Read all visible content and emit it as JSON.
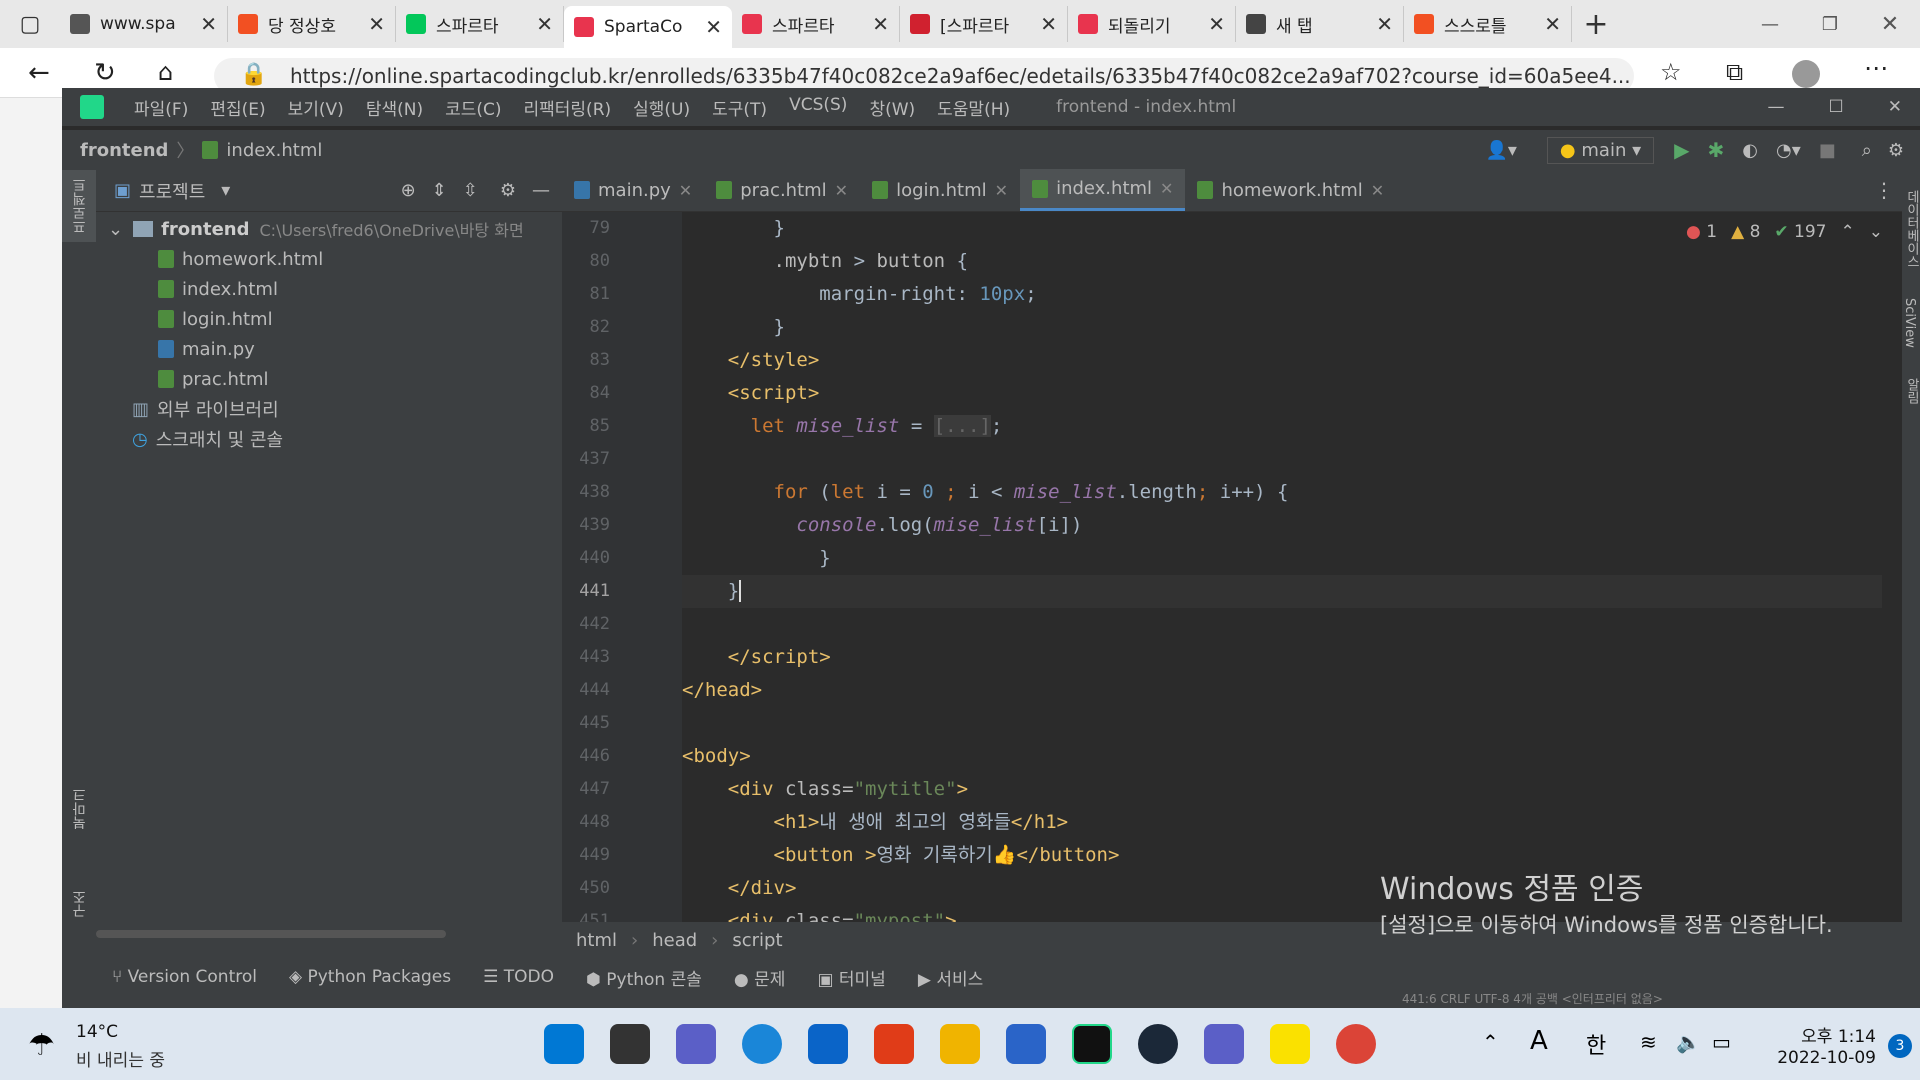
{
  "browser": {
    "tabs": [
      {
        "title": "www.spa",
        "color": "#555555"
      },
      {
        "title": "당 정상호",
        "color": "#f25022"
      },
      {
        "title": "스파르타",
        "color": "#03c75a"
      },
      {
        "title": "SpartaCo",
        "color": "#e8344e"
      },
      {
        "title": "스파르타",
        "color": "#e8344e"
      },
      {
        "title": "[스파르타",
        "color": "#d0212f"
      },
      {
        "title": "되돌리기",
        "color": "#e8344e"
      },
      {
        "title": "새 탭",
        "color": "#444444"
      },
      {
        "title": "스스로틀",
        "color": "#f25022"
      }
    ],
    "url": "https://online.spartacodingclub.kr/enrolleds/6335b47f40c082ce2a9af6ec/edetails/6335b47f40c082ce2a9af702?course_id=60a5ee4..."
  },
  "ide": {
    "menu": [
      "파일(F)",
      "편집(E)",
      "보기(V)",
      "탐색(N)",
      "코드(C)",
      "리팩터링(R)",
      "실행(U)",
      "도구(T)",
      "VCS(S)",
      "창(W)",
      "도움말(H)"
    ],
    "window_title": "frontend - index.html",
    "nav": {
      "project": "frontend",
      "file": "index.html",
      "run_config": "main"
    },
    "left_strip": {
      "project_label": "프로젝트",
      "bookmarks_label": "북마크",
      "structure_label": "구조"
    },
    "right_strip": {
      "db_label": "데이터베이스",
      "sciview_label": "SciView",
      "notif_label": "알림"
    },
    "project_panel": {
      "title": "프로젝트",
      "root": "frontend",
      "root_path": "C:\\Users\\fred6\\OneDrive\\바탕 화면",
      "files": [
        {
          "name": "homework.html",
          "type": "html"
        },
        {
          "name": "index.html",
          "type": "html"
        },
        {
          "name": "login.html",
          "type": "html"
        },
        {
          "name": "main.py",
          "type": "py"
        },
        {
          "name": "prac.html",
          "type": "html"
        }
      ],
      "external_libs": "외부 라이브러리",
      "scratches": "스크래치 및 콘솔"
    },
    "editor_tabs": [
      "main.py",
      "prac.html",
      "login.html",
      "index.html",
      "homework.html"
    ],
    "active_tab": "index.html",
    "inspections": {
      "errors": "1",
      "warnings": "8",
      "ok": "197"
    },
    "breadcrumbs": [
      "html",
      "head",
      "script"
    ],
    "tool_windows": [
      "Version Control",
      "Python Packages",
      "TODO",
      "Python 콘솔",
      "문제",
      "터미널",
      "서비스"
    ],
    "status_text": "441:6  CRLF  UTF-8  4개 공백  <인터프리터 없음>",
    "line_numbers": [
      "79",
      "80",
      "81",
      "82",
      "83",
      "84",
      "85",
      "437",
      "438",
      "439",
      "440",
      "441",
      "442",
      "443",
      "444",
      "445",
      "446",
      "447",
      "448",
      "449",
      "450",
      "451"
    ]
  },
  "activation": {
    "title": "Windows 정품 인증",
    "subtitle": "[설정]으로 이동하여 Windows를 정품 인증합니다."
  },
  "taskbar": {
    "weather_temp": "14°C",
    "weather_desc": "비 내리는 중",
    "ime_lang": "A",
    "ime_mode": "한",
    "time": "오후 1:14",
    "date": "2022-10-09",
    "notifications": "3"
  }
}
